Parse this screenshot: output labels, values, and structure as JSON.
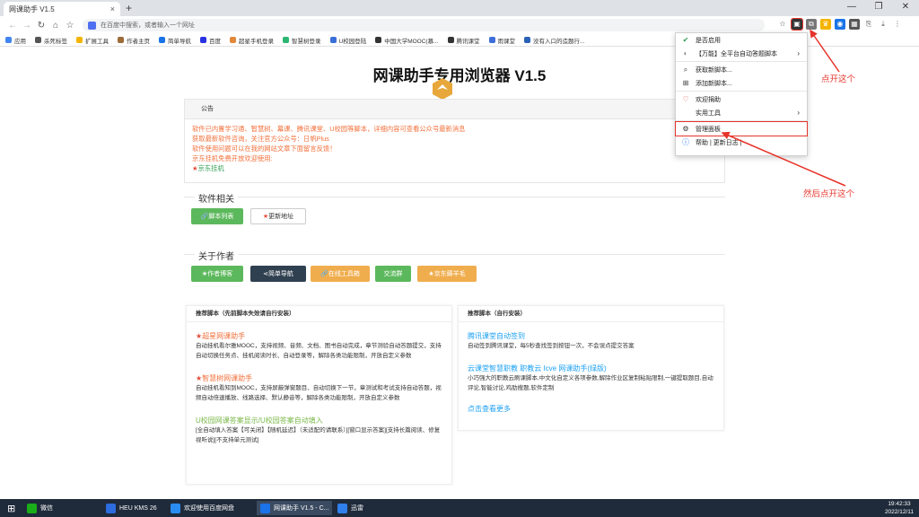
{
  "browser": {
    "tab_title": "网课助手 V1.5",
    "tab_close": "×",
    "new_tab": "+",
    "window_controls": [
      "—",
      "❐",
      "✕"
    ],
    "omnibox_placeholder": "在百度中搜索，或者输入一个网址",
    "bookmarks": [
      {
        "label": "应用",
        "color": "#4285f4"
      },
      {
        "label": "杀死标签",
        "color": "#555"
      },
      {
        "label": "扩展工具",
        "color": "#f4b400"
      },
      {
        "label": "作者主页",
        "color": "#9c6b3a"
      },
      {
        "label": "简单导航",
        "color": "#1a73e8"
      },
      {
        "label": "百度",
        "color": "#2932e1"
      },
      {
        "label": "超星手机登录",
        "color": "#e2893b"
      },
      {
        "label": "智慧树登录",
        "color": "#2bb673"
      },
      {
        "label": "U校园登陆",
        "color": "#3a6fd8"
      },
      {
        "label": "中国大学MOOC(慕...",
        "color": "#333"
      },
      {
        "label": "腾讯课堂",
        "color": "#333"
      },
      {
        "label": "雨课堂",
        "color": "#3f6ed8"
      },
      {
        "label": "没有入口的造题行...",
        "color": "#2a62b8"
      }
    ]
  },
  "page": {
    "title": "网课助手专用浏览器 V1.5",
    "notice": {
      "header": "公告",
      "lines": [
        "软件已内置学习通、智慧树、幕课、腾讯课堂、U校园等脚本，详细内容可查看公众号最新消息",
        "获取最新软件咨询，关注官方公众号：日帆Plus",
        "软件使用问题可以在我的网站文章下面留言反馈！",
        "京东挂机免费开放欢迎使用:"
      ],
      "star": "★",
      "link": "京东挂机"
    },
    "software": {
      "legend": "软件相关",
      "buttons": [
        {
          "label": "脚本列表",
          "color": "#5cb85c"
        },
        {
          "label": "更新地址",
          "color": "#ffffff"
        }
      ]
    },
    "author": {
      "legend": "关于作者",
      "buttons": [
        {
          "label": "作者博客",
          "color": "#5cb85c"
        },
        {
          "label": "简单导航",
          "color": "#2f4050"
        },
        {
          "label": "在线工具箱",
          "color": "#f0ad4e"
        },
        {
          "label": "交流群",
          "color": "#5cb85c"
        },
        {
          "label": "京东薅羊毛",
          "color": "#f0ad4e"
        }
      ]
    },
    "recommend_left": {
      "header": "推荐脚本（先前脚本失效请自行安装）",
      "items": [
        {
          "star": "★",
          "title": "超星网课助手",
          "desc": "自动挂机看尔雅MOOC，支持视频、音频、文档、图书自动完成，章节测验自动答题提交，支持自动切换任务点、挂机阅读时长、自动登录等，解除各类功能限制，开放自定义参数"
        },
        {
          "star": "★",
          "title": "智慧树网课助手",
          "desc": "自动挂机看知到MOOC，支持屏蔽弹窗题目、自动切换下一节，章测试和考试支持自动答题，视频自动倍速播放、线路选择、默认静音等，解除各类功能限制，开放自定义参数"
        },
        {
          "star": "",
          "title": "U校园网课答案显示/U校园答案自动填入",
          "desc": "[全自动填入答案【可关闭】【随机延迟】（未适配的请联系）][窗口显示答案][支持长篇阅读、修复视听说][不支持单元测试]"
        }
      ]
    },
    "recommend_right": {
      "header": "推荐脚本（自行安装）",
      "items": [
        {
          "title": "腾讯课堂自动签到",
          "desc": "自动签到腾讯课堂，每5秒查找签到按钮一次，不会误点提交答案"
        },
        {
          "title": "云课堂智慧职教 职教云 Icve 网课助手(绿版)",
          "desc": "小巧强大的职教云刷课脚本,中文化自定义各项参数,解除作业区复制粘贴限制,一键提取题目,自动评论,智能讨论,鸡肋搜题,软件定制"
        }
      ],
      "more": "点击查看更多"
    }
  },
  "menu": {
    "items": [
      {
        "icon": "✔",
        "label": "是否启用",
        "arrow": ""
      },
      {
        "icon": "◐",
        "label": "【万能】全平台自动答题脚本",
        "arrow": "›"
      },
      {
        "icon": "⌕",
        "label": "获取新脚本...",
        "arrow": ""
      },
      {
        "icon": "⊞",
        "label": "添加新脚本...",
        "arrow": ""
      },
      {
        "icon": "♡",
        "label": "欢迎捐助",
        "arrow": ""
      },
      {
        "icon": "",
        "label": "实用工具",
        "arrow": "›"
      },
      {
        "icon": "⚙",
        "label": "管理面板",
        "arrow": ""
      },
      {
        "icon": "ⓘ",
        "label": "帮助 | 更新日志 |",
        "arrow": ""
      }
    ]
  },
  "annotations": {
    "first": "点开这个",
    "second": "然后点开这个"
  },
  "taskbar": {
    "apps": [
      {
        "label": "微信",
        "color": "#1aad19"
      },
      {
        "label": "HEU KMS 26",
        "color": "#2d6cdf"
      },
      {
        "label": "欢迎使用百度网盘",
        "color": "#2a8cf0"
      },
      {
        "label": "网课助手 V1.5 - C...",
        "color": "#1a73e8"
      },
      {
        "label": "迅雷",
        "color": "#2f80ed"
      }
    ],
    "time": "19:42:33",
    "date": "2022/12/11"
  }
}
